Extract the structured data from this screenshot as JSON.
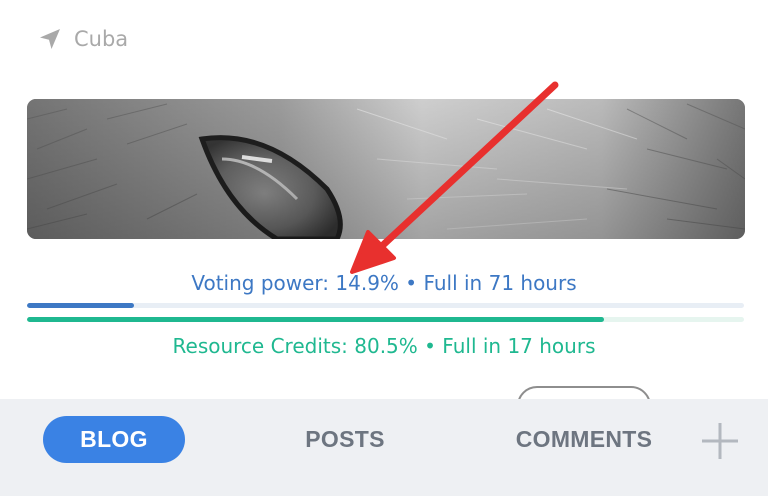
{
  "location": {
    "icon": "navigation-arrow-icon",
    "label": "Cuba"
  },
  "cover_image": {
    "description_icon": "cover-image"
  },
  "voting_power": {
    "text": "Voting power: 14.9% • Full in 71 hours",
    "percent": 14.9,
    "color": "#3d78c4"
  },
  "resource_credits": {
    "text": "Resource Credits: 80.5% • Full in 17 hours",
    "percent": 80.5,
    "color": "#1fb890"
  },
  "annotation": {
    "icon": "red-arrow-annotation",
    "color": "#e8302e"
  },
  "tabs": [
    {
      "label": "BLOG",
      "active": true
    },
    {
      "label": "POSTS",
      "active": false
    },
    {
      "label": "COMMENTS",
      "active": false
    }
  ],
  "add_button": {
    "icon": "plus-icon"
  },
  "colors": {
    "accent": "#3a82e4",
    "tab_inactive": "#6d7580",
    "tabbar_bg": "#eef0f3"
  }
}
